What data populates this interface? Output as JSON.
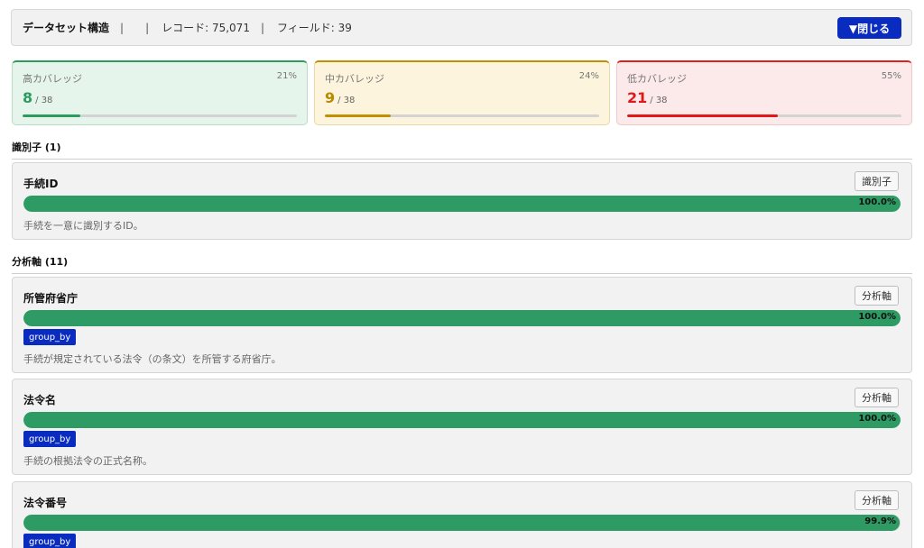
{
  "header": {
    "title": "データセット構造",
    "sep1": "|",
    "sep2": "|",
    "records": "レコード: 75,071",
    "sep3": "|",
    "fields": "フィールド: 39",
    "close_label": "▼閉じる"
  },
  "coverage": {
    "high": {
      "label": "高カバレッジ",
      "count": "8",
      "total": "/ 38",
      "pct_label": "21%",
      "fraction": 0.21
    },
    "mid": {
      "label": "中カバレッジ",
      "count": "9",
      "total": "/ 38",
      "pct_label": "24%",
      "fraction": 0.24
    },
    "low": {
      "label": "低カバレッジ",
      "count": "21",
      "total": "/ 38",
      "pct_label": "55%",
      "fraction": 0.55
    }
  },
  "sections": {
    "identifier": {
      "heading": "識別子 (1)"
    },
    "axis": {
      "heading": "分析軸 (11)"
    }
  },
  "fields": [
    {
      "name": "手続ID",
      "tag": "識別子",
      "pct_label": "100.0%",
      "fraction": 1.0,
      "group_by": "",
      "desc": "手続を一意に識別するID。"
    },
    {
      "name": "所管府省庁",
      "tag": "分析軸",
      "pct_label": "100.0%",
      "fraction": 1.0,
      "group_by": "group_by",
      "desc": "手続が規定されている法令（の条文）を所管する府省庁。"
    },
    {
      "name": "法令名",
      "tag": "分析軸",
      "pct_label": "100.0%",
      "fraction": 1.0,
      "group_by": "group_by",
      "desc": "手続の根拠法令の正式名称。"
    },
    {
      "name": "法令番号",
      "tag": "分析軸",
      "pct_label": "99.9%",
      "fraction": 0.999,
      "group_by": "group_by",
      "desc": ""
    }
  ],
  "colors": {
    "accent": "#0a2bbf",
    "bar_green": "#2e9b64",
    "high": "#2e9b5e",
    "mid": "#c09000",
    "low": "#e01818"
  }
}
